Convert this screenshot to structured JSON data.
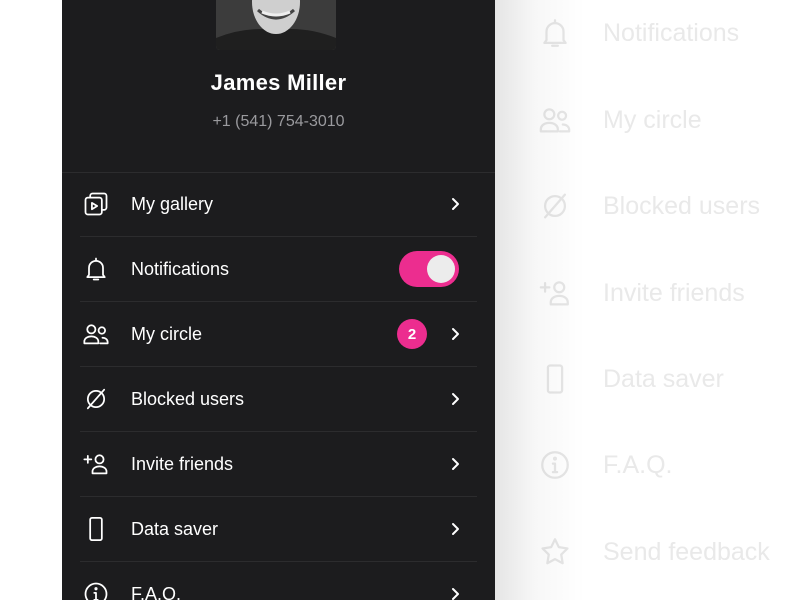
{
  "profile": {
    "name": "James Miller",
    "phone": "+1 (541) 754-3010"
  },
  "menu": {
    "items": [
      {
        "label": "My gallery",
        "icon": "gallery-icon"
      },
      {
        "label": "Notifications",
        "icon": "bell-icon",
        "toggle_on": true
      },
      {
        "label": "My circle",
        "icon": "people-icon",
        "badge": "2"
      },
      {
        "label": "Blocked users",
        "icon": "blocked-icon"
      },
      {
        "label": "Invite friends",
        "icon": "add-user-icon"
      },
      {
        "label": "Data saver",
        "icon": "phone-icon"
      },
      {
        "label": "F.A.Q.",
        "icon": "info-icon"
      }
    ]
  },
  "background_menu": {
    "items": [
      {
        "label": "Notifications",
        "icon": "bell-icon"
      },
      {
        "label": "My circle",
        "icon": "people-icon"
      },
      {
        "label": "Blocked users",
        "icon": "blocked-icon"
      },
      {
        "label": "Invite friends",
        "icon": "add-user-icon"
      },
      {
        "label": "Data saver",
        "icon": "phone-icon"
      },
      {
        "label": "F.A.Q.",
        "icon": "info-icon"
      },
      {
        "label": "Send feedback",
        "icon": "star-icon"
      }
    ]
  },
  "colors": {
    "drawer_bg": "#1c1c1e",
    "accent": "#ec2d8f",
    "text_primary": "#ffffff",
    "text_secondary": "#9a9a9e",
    "faded_text": "#e9e9e9"
  }
}
